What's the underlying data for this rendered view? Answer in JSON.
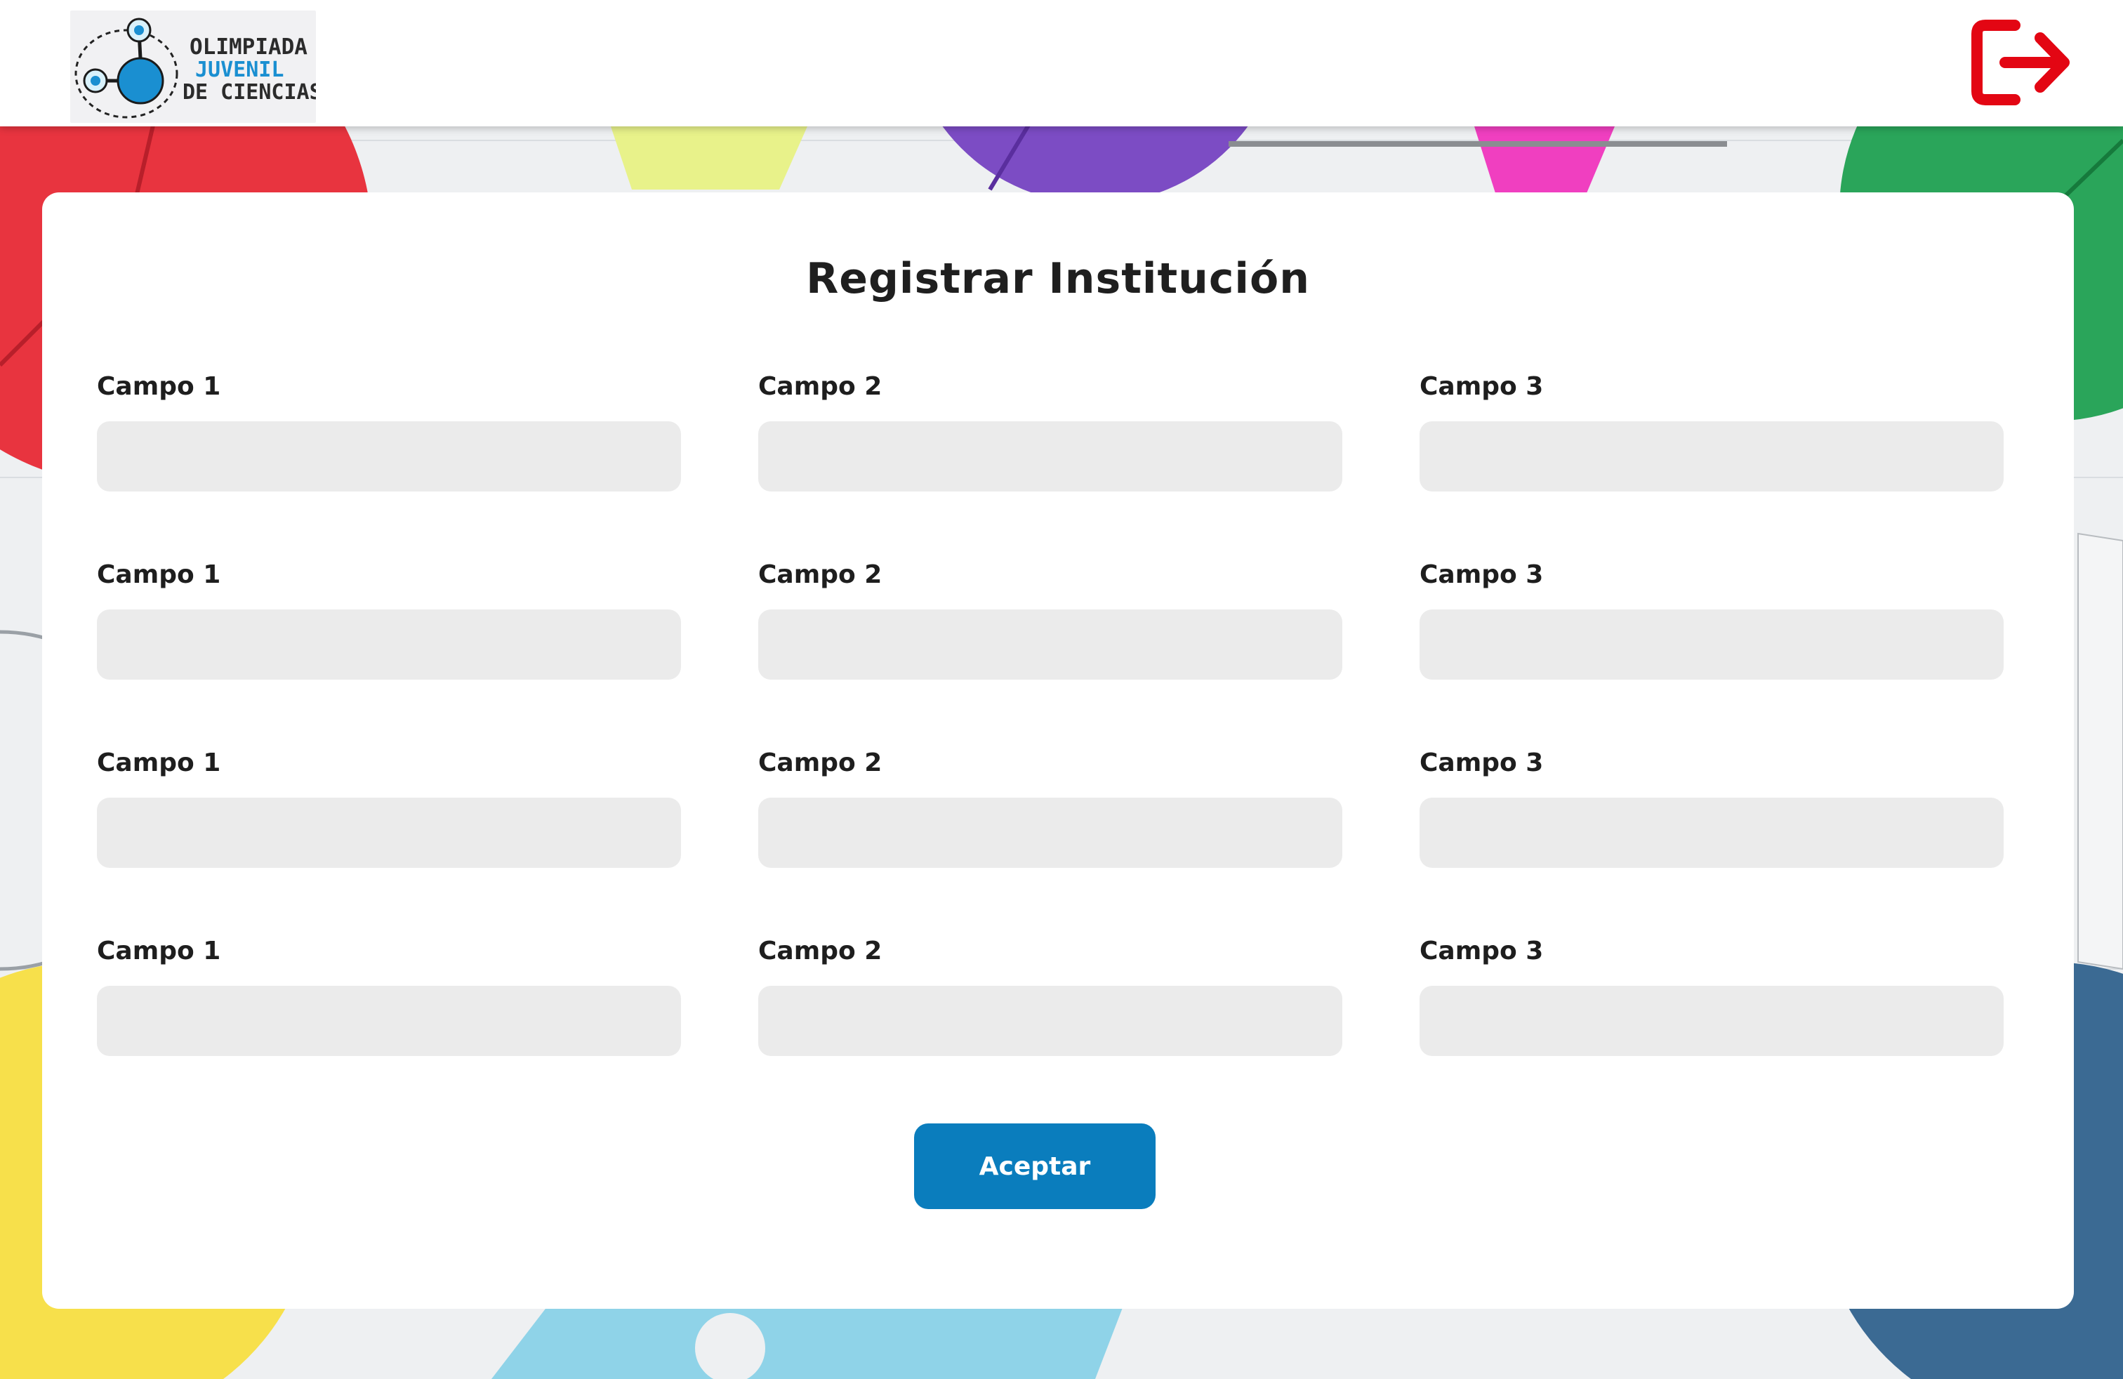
{
  "header": {
    "logo": {
      "line1": "OLIMPIADA",
      "line2": "JUVENIL",
      "line3": "DE CIENCIAS"
    },
    "logout_icon": "logout-arrow-icon",
    "logout_color": "#e30613"
  },
  "form": {
    "title": "Registrar Institución",
    "rows": [
      {
        "fields": [
          {
            "label": "Campo 1",
            "value": ""
          },
          {
            "label": "Campo 2",
            "value": ""
          },
          {
            "label": "Campo 3",
            "value": ""
          }
        ]
      },
      {
        "fields": [
          {
            "label": "Campo 1",
            "value": ""
          },
          {
            "label": "Campo 2",
            "value": ""
          },
          {
            "label": "Campo 3",
            "value": ""
          }
        ]
      },
      {
        "fields": [
          {
            "label": "Campo 1",
            "value": ""
          },
          {
            "label": "Campo 2",
            "value": ""
          },
          {
            "label": "Campo 3",
            "value": ""
          }
        ]
      },
      {
        "fields": [
          {
            "label": "Campo 1",
            "value": ""
          },
          {
            "label": "Campo 2",
            "value": ""
          },
          {
            "label": "Campo 3",
            "value": ""
          }
        ]
      }
    ],
    "submit_label": "Aceptar",
    "submit_color": "#0a7dbd"
  }
}
